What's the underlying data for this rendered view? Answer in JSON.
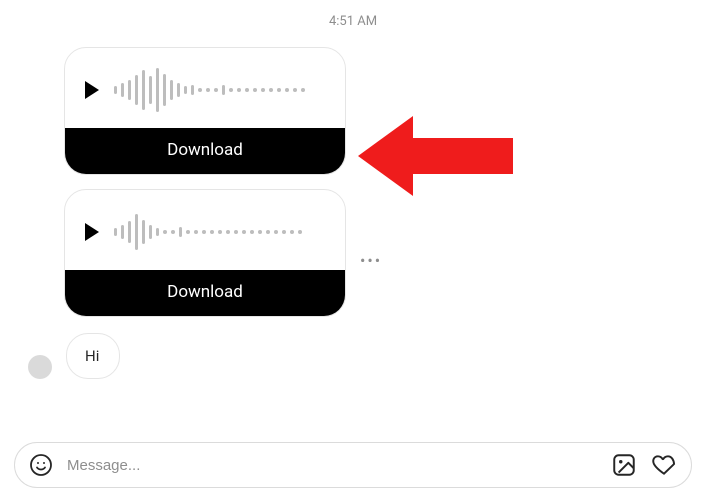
{
  "timestamp": "4:51 AM",
  "voice_messages": [
    {
      "download_label": "Download"
    },
    {
      "download_label": "Download"
    }
  ],
  "options_glyph": "•••",
  "text_message": {
    "text": "Hi"
  },
  "composer": {
    "placeholder": "Message..."
  }
}
